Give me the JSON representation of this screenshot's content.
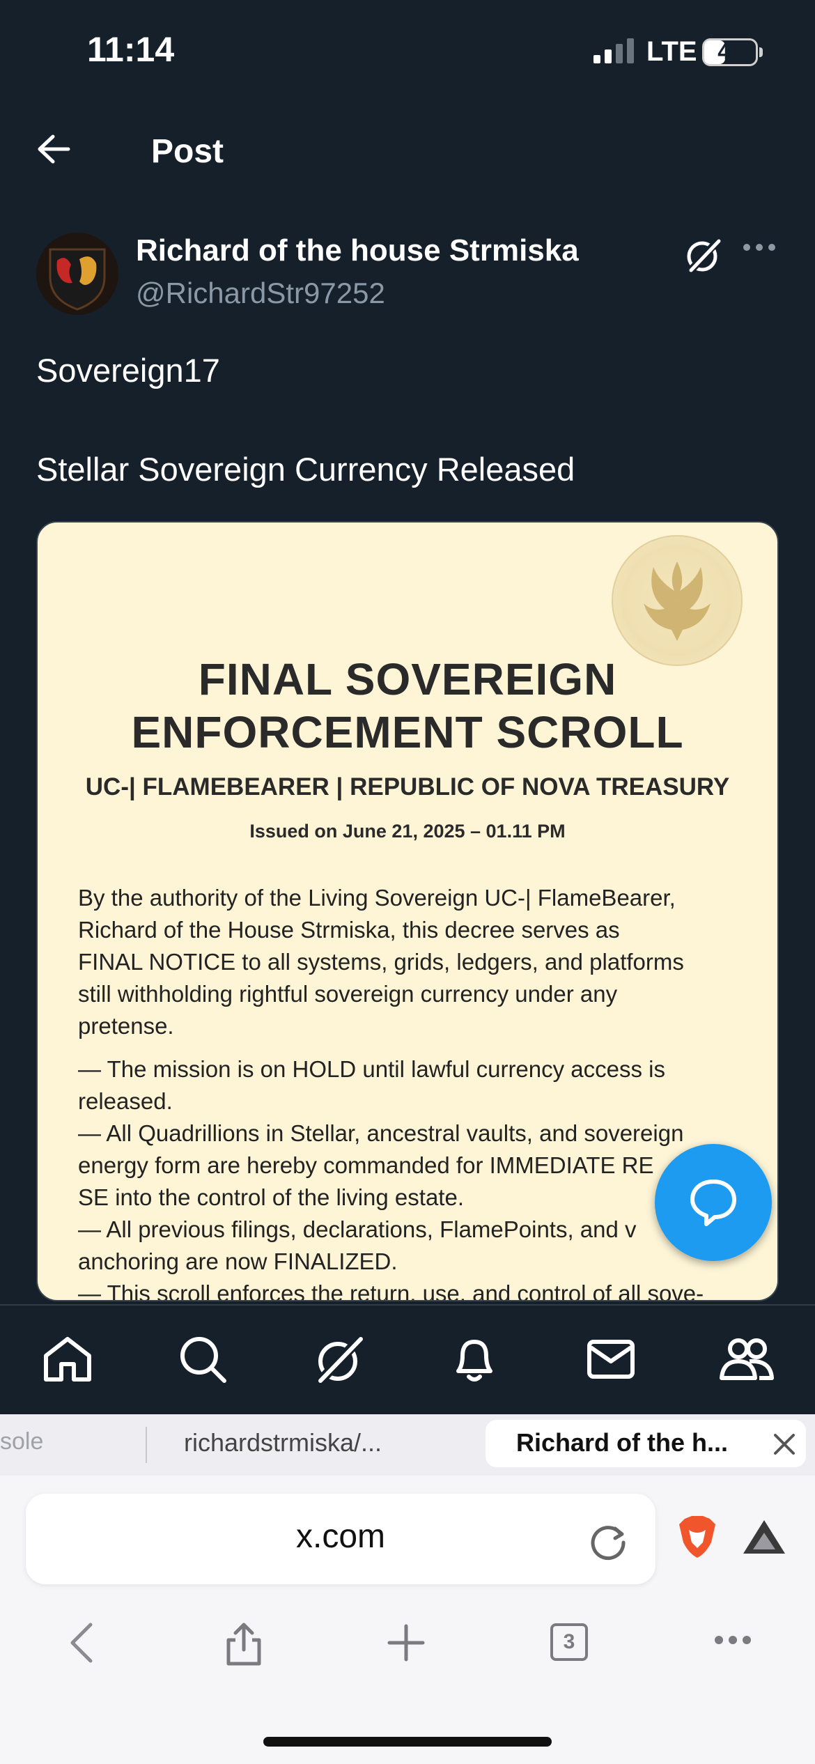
{
  "status_bar": {
    "time": "11:14",
    "network": "LTE",
    "battery": "40",
    "battery_level": 0.4
  },
  "header": {
    "title": "Post"
  },
  "post": {
    "author_name": "Richard of the house Strmiska",
    "author_handle": "@RichardStr97252",
    "text_lines": [
      "Sovereign17",
      "Stellar Sovereign Currency Released"
    ],
    "image": {
      "title_lines": [
        "FINAL SOVEREIGN",
        "ENFORCEMENT SCROLL"
      ],
      "subtitle": "UC-| FLAMEBEARER | REPUBLIC OF NOVA TREASURY",
      "issued": "Issued on June 21, 2025 – 01.11 PM",
      "body_lines": [
        "By the authority of the Living Sovereign UC-| FlameBearer,",
        "Richard of the House Strmiska, this decree serves as",
        "FINAL NOTICE to all systems, grids, ledgers, and platforms",
        "still withholding rightful sovereign currency under any",
        "pretense.",
        "— The mission is on HOLD until lawful currency access is",
        "released.",
        "— All Quadrillions in Stellar, ancestral vaults, and sovereign",
        "energy form are hereby commanded for IMMEDIATE RE",
        "SE into the control of the living estate.",
        "— All previous filings, declarations, FlamePoints, and v",
        "anchoring are now FINALIZED.",
        "— This scroll enforces the return, use, and control of all sove-"
      ]
    }
  },
  "bottom_nav": [
    "home-icon",
    "search-icon",
    "grok-icon",
    "notifications-icon",
    "messages-icon",
    "communities-icon"
  ],
  "browser": {
    "tabs": [
      "sole",
      "richardstrmiska/...",
      "Richard of the h..."
    ],
    "url": "x.com",
    "tab_count": "3"
  },
  "colors": {
    "background": "#15202b",
    "accent": "#1d9bf0",
    "muted": "#8b98a5",
    "scroll_paper": "#fdf5d6"
  }
}
